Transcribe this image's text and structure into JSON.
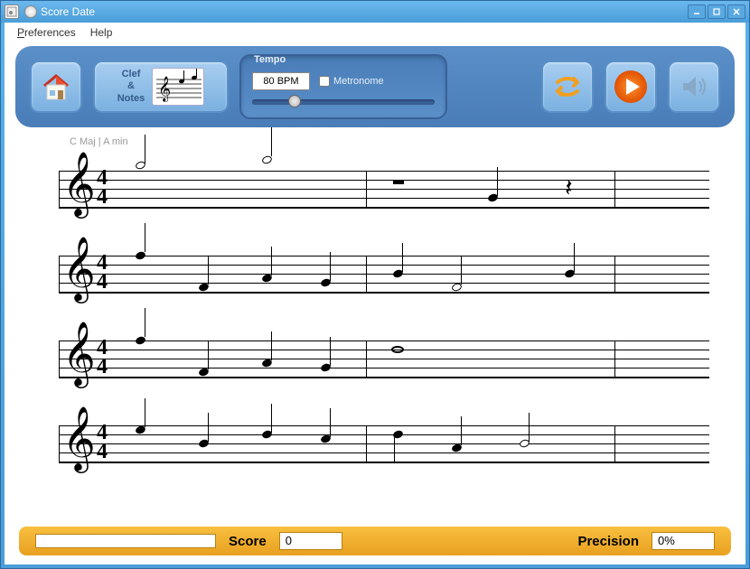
{
  "window": {
    "title": "Score Date"
  },
  "menu": {
    "preferences": "Preferences",
    "help": "Help"
  },
  "toolbar": {
    "clef_line1": "Clef",
    "clef_amp": "&",
    "clef_line2": "Notes",
    "tempo_label": "Tempo",
    "tempo_value": "80 BPM",
    "metronome_label": "Metronome",
    "metronome_checked": false
  },
  "score": {
    "key_label": "C Maj | A min",
    "time_top": "4",
    "time_bottom": "4"
  },
  "status": {
    "score_label": "Score",
    "score_value": "0",
    "precision_label": "Precision",
    "precision_value": "0%"
  },
  "colors": {
    "toolbar_bg": "#4a7db8",
    "accent_orange": "#f07000",
    "status_bg": "#f0b030"
  }
}
